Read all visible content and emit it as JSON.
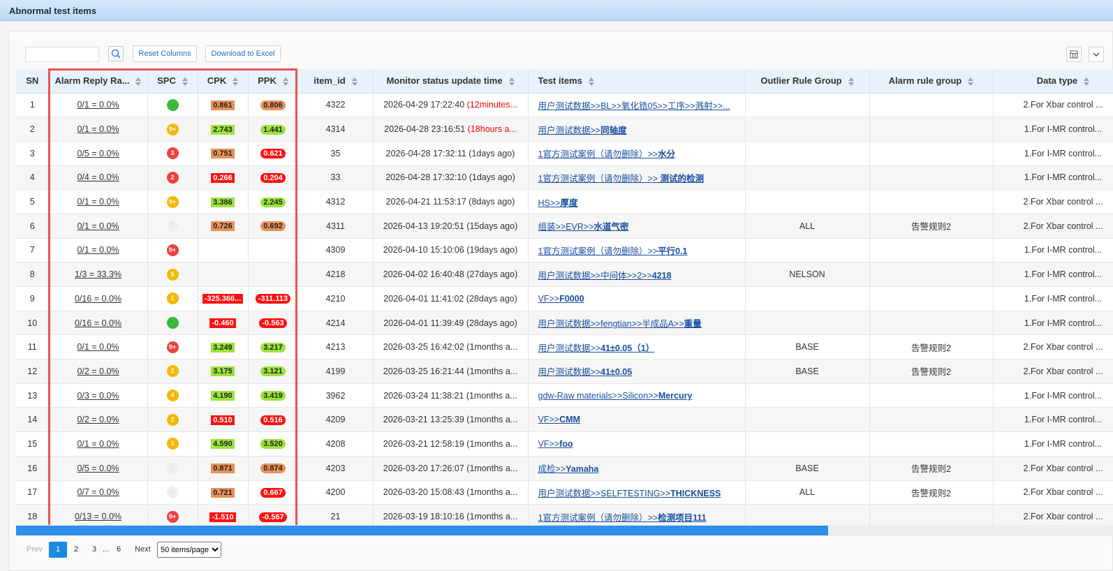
{
  "window": {
    "title": "Abnormal test items"
  },
  "toolbar": {
    "search_value": "",
    "reset_label": "Reset Columns",
    "download_label": "Download to Excel"
  },
  "columns": [
    "SN",
    "Alarm Reply Ra...",
    "SPC",
    "CPK",
    "PPK",
    "item_id",
    "Monitor status update time",
    "Test items",
    "Outlier Rule Group",
    "Alarm rule group",
    "Data type"
  ],
  "colors": {
    "accent": "#1e88e5",
    "highlight_box": "#e95252",
    "cpk_orange": "#e8915a",
    "cpk_green": "#9be43a",
    "cpk_red": "#ff1010",
    "spc_green": "#3cb83c",
    "spc_yellow": "#f5b800",
    "spc_red": "#ef4040"
  },
  "rows": [
    {
      "sn": "1",
      "rate": "0/1 = 0.0%",
      "spc": "",
      "spc_color": "green",
      "cpk": "0.861",
      "cpk_color": "orange",
      "ppk": "0.806",
      "ppk_color": "orange",
      "item_id": "4322",
      "time": "2026-04-29 17:22:40 ",
      "ago": "(12minutes...",
      "ago_red": true,
      "test_pre": "用户测试数据>>BL>>氧化锆05>>工序>>溅射>>...",
      "test_bold": "",
      "outlier": "",
      "alarm": "",
      "dtype": "2.For Xbar control ..."
    },
    {
      "sn": "2",
      "rate": "0/1 = 0.0%",
      "spc": "9+",
      "spc_color": "yellow",
      "cpk": "2.743",
      "cpk_color": "green",
      "ppk": "1.441",
      "ppk_color": "green",
      "item_id": "4314",
      "time": "2026-04-28 23:16:51 ",
      "ago": "(18hours a...",
      "ago_red": true,
      "test_pre": "用户测试数据>>",
      "test_bold": "同轴度",
      "outlier": "",
      "alarm": "",
      "dtype": "1.For I-MR control..."
    },
    {
      "sn": "3",
      "rate": "0/5 = 0.0%",
      "spc": "3",
      "spc_color": "red",
      "cpk": "0.751",
      "cpk_color": "orange",
      "ppk": "0.621",
      "ppk_color": "red",
      "item_id": "35",
      "time": "2026-04-28 17:32:11 (1days ago)",
      "ago": "",
      "ago_red": false,
      "test_pre": "1官方测试案例（请勿删除）>>",
      "test_bold": "水分",
      "outlier": "",
      "alarm": "",
      "dtype": "1.For I-MR control..."
    },
    {
      "sn": "4",
      "rate": "0/4 = 0.0%",
      "spc": "2",
      "spc_color": "red",
      "cpk": "0.266",
      "cpk_color": "red",
      "ppk": "0.204",
      "ppk_color": "red",
      "item_id": "33",
      "time": "2026-04-28 17:32:10 (1days ago)",
      "ago": "",
      "ago_red": false,
      "test_pre": "1官方测试案例（请勿删除）>> ",
      "test_bold": "测试的检测",
      "outlier": "",
      "alarm": "",
      "dtype": "1.For I-MR control..."
    },
    {
      "sn": "5",
      "rate": "0/1 = 0.0%",
      "spc": "9+",
      "spc_color": "yellow",
      "cpk": "3.386",
      "cpk_color": "green",
      "ppk": "2.245",
      "ppk_color": "green",
      "item_id": "4312",
      "time": "2026-04-21 11:53:17 (8days ago)",
      "ago": "",
      "ago_red": false,
      "test_pre": "HS>>",
      "test_bold": "厚度",
      "outlier": "",
      "alarm": "",
      "dtype": "2.For Xbar control ..."
    },
    {
      "sn": "6",
      "rate": "0/1 = 0.0%",
      "spc": "?",
      "spc_color": "gray",
      "cpk": "0.726",
      "cpk_color": "orange",
      "ppk": "0.692",
      "ppk_color": "orange",
      "item_id": "4311",
      "time": "2026-04-13 19:20:51 (15days ago)",
      "ago": "",
      "ago_red": false,
      "test_pre": "组装>>EVR>>",
      "test_bold": "水道气密",
      "outlier": "ALL",
      "alarm": "告警规则2",
      "dtype": "2.For Xbar control ..."
    },
    {
      "sn": "7",
      "rate": "0/1 = 0.0%",
      "spc": "9+",
      "spc_color": "red",
      "cpk": "",
      "cpk_color": "",
      "ppk": "",
      "ppk_color": "",
      "item_id": "4309",
      "time": "2026-04-10 15:10:06 (19days ago)",
      "ago": "",
      "ago_red": false,
      "test_pre": "1官方测试案例（请勿删除）>>",
      "test_bold": "平行0.1",
      "outlier": "",
      "alarm": "",
      "dtype": "1.For I-MR control..."
    },
    {
      "sn": "8",
      "rate": "1/3 = 33.3%",
      "spc": "5",
      "spc_color": "yellow",
      "cpk": "",
      "cpk_color": "",
      "ppk": "",
      "ppk_color": "",
      "item_id": "4218",
      "time": "2026-04-02 16:40:48 (27days ago)",
      "ago": "",
      "ago_red": false,
      "test_pre": "用户测试数据>>中间体>>2>>",
      "test_bold": "4218",
      "outlier": "NELSON",
      "alarm": "",
      "dtype": "1.For I-MR control..."
    },
    {
      "sn": "9",
      "rate": "0/16 = 0.0%",
      "spc": "1",
      "spc_color": "yellow",
      "cpk": "-325.366...",
      "cpk_color": "red",
      "ppk": "-311.113",
      "ppk_color": "red",
      "item_id": "4210",
      "time": "2026-04-01 11:41:02 (28days ago)",
      "ago": "",
      "ago_red": false,
      "test_pre": "VF>>",
      "test_bold": "F0000",
      "outlier": "",
      "alarm": "",
      "dtype": "1.For I-MR control..."
    },
    {
      "sn": "10",
      "rate": "0/16 = 0.0%",
      "spc": "",
      "spc_color": "green",
      "cpk": "-0.460",
      "cpk_color": "red",
      "ppk": "-0.563",
      "ppk_color": "red",
      "item_id": "4214",
      "time": "2026-04-01 11:39:49 (28days ago)",
      "ago": "",
      "ago_red": false,
      "test_pre": "用户测试数据>>fengtian>>半成品A>>",
      "test_bold": "重量",
      "outlier": "",
      "alarm": "",
      "dtype": "1.For I-MR control..."
    },
    {
      "sn": "11",
      "rate": "0/1 = 0.0%",
      "spc": "9+",
      "spc_color": "red",
      "cpk": "3.249",
      "cpk_color": "green",
      "ppk": "3.217",
      "ppk_color": "green",
      "item_id": "4213",
      "time": "2026-03-25 16:42:02 (1months a...",
      "ago": "",
      "ago_red": false,
      "test_pre": "用户测试数据>>",
      "test_bold": "41±0.05（1）",
      "outlier": "BASE",
      "alarm": "告警规则2",
      "dtype": "2.For Xbar control ..."
    },
    {
      "sn": "12",
      "rate": "0/2 = 0.0%",
      "spc": "2",
      "spc_color": "yellow",
      "cpk": "3.175",
      "cpk_color": "green",
      "ppk": "3.121",
      "ppk_color": "green",
      "item_id": "4199",
      "time": "2026-03-25 16:21:44 (1months a...",
      "ago": "",
      "ago_red": false,
      "test_pre": "用户测试数据>>",
      "test_bold": "41±0.05",
      "outlier": "BASE",
      "alarm": "告警规则2",
      "dtype": "2.For Xbar control ..."
    },
    {
      "sn": "13",
      "rate": "0/3 = 0.0%",
      "spc": "4",
      "spc_color": "yellow",
      "cpk": "4.190",
      "cpk_color": "green",
      "ppk": "3.419",
      "ppk_color": "green",
      "item_id": "3962",
      "time": "2026-03-24 11:38:21 (1months a...",
      "ago": "",
      "ago_red": false,
      "test_pre": "gdw-Raw materials>>Silicon>>",
      "test_bold": "Mercury",
      "outlier": "",
      "alarm": "",
      "dtype": "1.For I-MR control..."
    },
    {
      "sn": "14",
      "rate": "0/2 = 0.0%",
      "spc": "2",
      "spc_color": "yellow",
      "cpk": "0.510",
      "cpk_color": "red",
      "ppk": "0.516",
      "ppk_color": "red",
      "item_id": "4209",
      "time": "2026-03-21 13:25:39 (1months a...",
      "ago": "",
      "ago_red": false,
      "test_pre": "VF>>",
      "test_bold": "CMM",
      "outlier": "",
      "alarm": "",
      "dtype": "1.For I-MR control..."
    },
    {
      "sn": "15",
      "rate": "0/1 = 0.0%",
      "spc": "1",
      "spc_color": "yellow",
      "cpk": "4.590",
      "cpk_color": "green",
      "ppk": "3.520",
      "ppk_color": "green",
      "item_id": "4208",
      "time": "2026-03-21 12:58:19 (1months a...",
      "ago": "",
      "ago_red": false,
      "test_pre": "VF>>",
      "test_bold": "foo",
      "outlier": "",
      "alarm": "",
      "dtype": "1.For I-MR control..."
    },
    {
      "sn": "16",
      "rate": "0/5 = 0.0%",
      "spc": "?",
      "spc_color": "gray",
      "cpk": "0.871",
      "cpk_color": "orange",
      "ppk": "0.874",
      "ppk_color": "orange",
      "item_id": "4203",
      "time": "2026-03-20 17:26:07 (1months a...",
      "ago": "",
      "ago_red": false,
      "test_pre": "成检>>",
      "test_bold": "Yamaha",
      "outlier": "BASE",
      "alarm": "告警规则2",
      "dtype": "2.For Xbar control ..."
    },
    {
      "sn": "17",
      "rate": "0/7 = 0.0%",
      "spc": "?",
      "spc_color": "gray",
      "cpk": "0.721",
      "cpk_color": "orange",
      "ppk": "0.667",
      "ppk_color": "red",
      "item_id": "4200",
      "time": "2026-03-20 15:08:43 (1months a...",
      "ago": "",
      "ago_red": false,
      "test_pre": "用户测试数据>>SELFTESTING>>",
      "test_bold": "THICKNESS",
      "outlier": "ALL",
      "alarm": "告警规则2",
      "dtype": "2.For Xbar control ..."
    },
    {
      "sn": "18",
      "rate": "0/13 = 0.0%",
      "spc": "9+",
      "spc_color": "red",
      "cpk": "-1.510",
      "cpk_color": "red",
      "ppk": "-0.567",
      "ppk_color": "red",
      "item_id": "21",
      "time": "2026-03-19 18:10:16 (1months a...",
      "ago": "",
      "ago_red": false,
      "test_pre": "1官方测试案例（请勿删除）>>",
      "test_bold": "检测项目111",
      "outlier": "",
      "alarm": "",
      "dtype": "2.For Xbar control ..."
    }
  ],
  "pagination": {
    "prev": "Prev",
    "pages": [
      "1",
      "2",
      "3"
    ],
    "ellipsis": "...",
    "last": "6",
    "next": "Next",
    "page_size": "50 items/page",
    "current": 1,
    "scroll_position": 0.74
  }
}
